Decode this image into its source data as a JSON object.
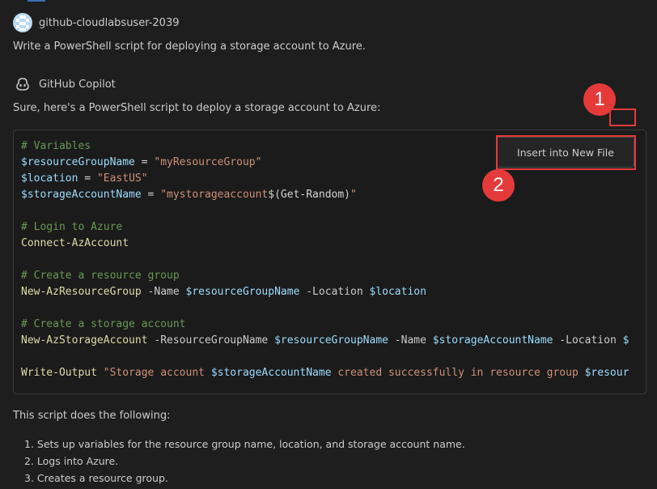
{
  "user": {
    "name": "github-cloudlabsuser-2039",
    "message": "Write a PowerShell script for deploying a storage account to Azure."
  },
  "assistant": {
    "name": "GitHub Copilot",
    "intro": "Sure, here's a PowerShell script to deploy a storage account to Azure:"
  },
  "code": {
    "l1": "# Variables",
    "l2_var": "$resourceGroupName",
    "l2_op": " = ",
    "l2_str": "\"myResourceGroup\"",
    "l3_var": "$location",
    "l3_op": " = ",
    "l3_str": "\"EastUS\"",
    "l4_var": "$storageAccountName",
    "l4_op": " = ",
    "l4_str_a": "\"mystorageaccount",
    "l4_sub": "$(Get-Random)",
    "l4_str_b": "\"",
    "l5": "# Login to Azure",
    "l6": "Connect-AzAccount",
    "l7": "# Create a resource group",
    "l8_cmd": "New-AzResourceGroup",
    "l8_p1": " -Name ",
    "l8_v1": "$resourceGroupName",
    "l8_p2": " -Location ",
    "l8_v2": "$location",
    "l9": "# Create a storage account",
    "l10_cmd": "New-AzStorageAccount",
    "l10_p1": " -ResourceGroupName ",
    "l10_v1": "$resourceGroupName",
    "l10_p2": " -Name ",
    "l10_v2": "$storageAccountName",
    "l10_p3": " -Location ",
    "l10_v3": "$",
    "l11_cmd": "Write-Output",
    "l11_s1": " \"Storage account ",
    "l11_v1": "$storageAccountName",
    "l11_s2": " created successfully in resource group ",
    "l11_v2": "$resour"
  },
  "insert_button": {
    "label": "Insert into New File"
  },
  "markers": {
    "m1": "1",
    "m2": "2"
  },
  "summary": {
    "intro": "This script does the following:",
    "steps": [
      "1. Sets up variables for the resource group name, location, and storage account name.",
      "2. Logs into Azure.",
      "3. Creates a resource group."
    ]
  },
  "colors": {
    "background": "#1e1e1e",
    "highlight": "#e53a3a",
    "comment": "#6a9955",
    "variable": "#9cdcfe",
    "string": "#ce9178",
    "command": "#dcdcaa"
  }
}
